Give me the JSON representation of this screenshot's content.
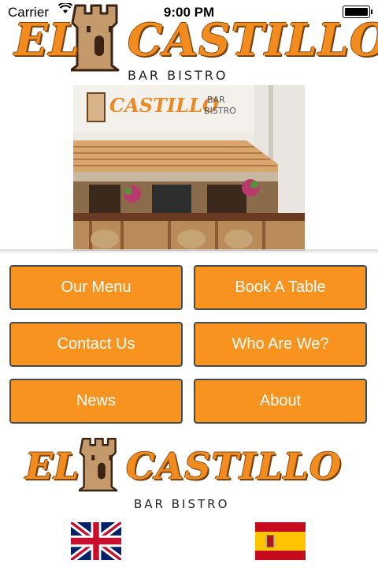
{
  "status_bar": {
    "carrier": "Carrier",
    "time": "9:00 PM"
  },
  "logo": {
    "name": "EL CASTILLO",
    "tagline": "BAR BISTRO"
  },
  "photo": {
    "sign_name": "CASTILLO",
    "sign_sub_1": "BAR",
    "sign_sub_2": "BISTRO"
  },
  "menu": {
    "our_menu": "Our Menu",
    "book_table": "Book A Table",
    "contact_us": "Contact Us",
    "who_are_we": "Who Are We?",
    "news": "News",
    "about": "About"
  },
  "languages": {
    "english": {
      "icon": "uk-flag-icon"
    },
    "spanish": {
      "icon": "spain-flag-icon"
    }
  },
  "colors": {
    "accent": "#f7931e",
    "button_border": "#3f4d52",
    "logo_orange": "#f28c1e"
  }
}
